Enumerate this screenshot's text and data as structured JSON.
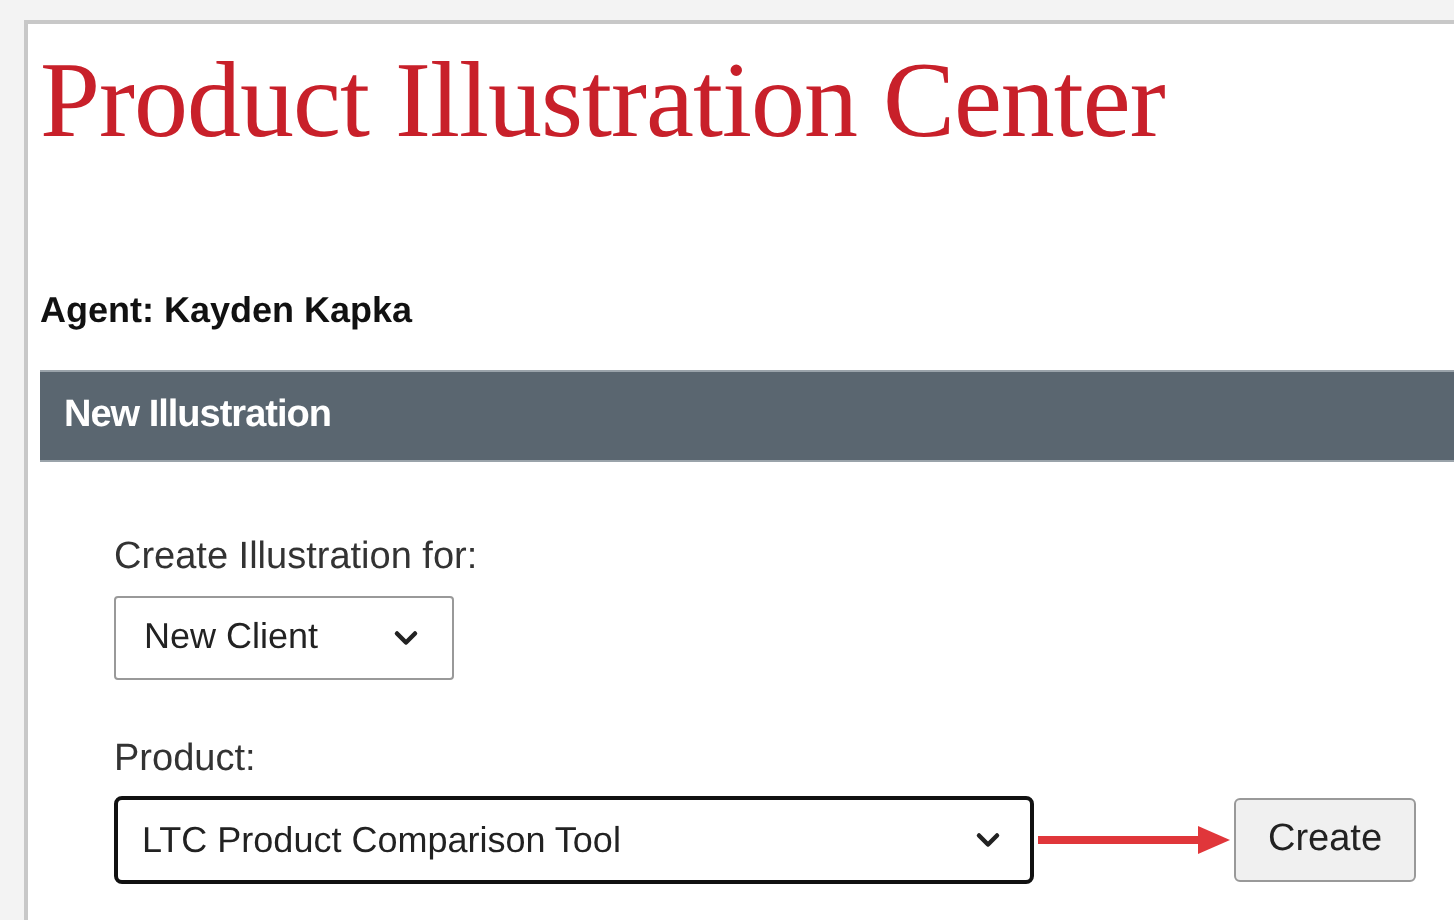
{
  "page_title": "Product Illustration Center",
  "agent": "Agent: Kayden Kapka",
  "section": {
    "title": "New Illustration",
    "fields": [
      {
        "label": "Create Illustration for:",
        "value": "New Client",
        "wide": false
      },
      {
        "label": "Product:",
        "value": "LTC Product Comparison Tool",
        "wide": true
      }
    ],
    "button": "Create"
  }
}
